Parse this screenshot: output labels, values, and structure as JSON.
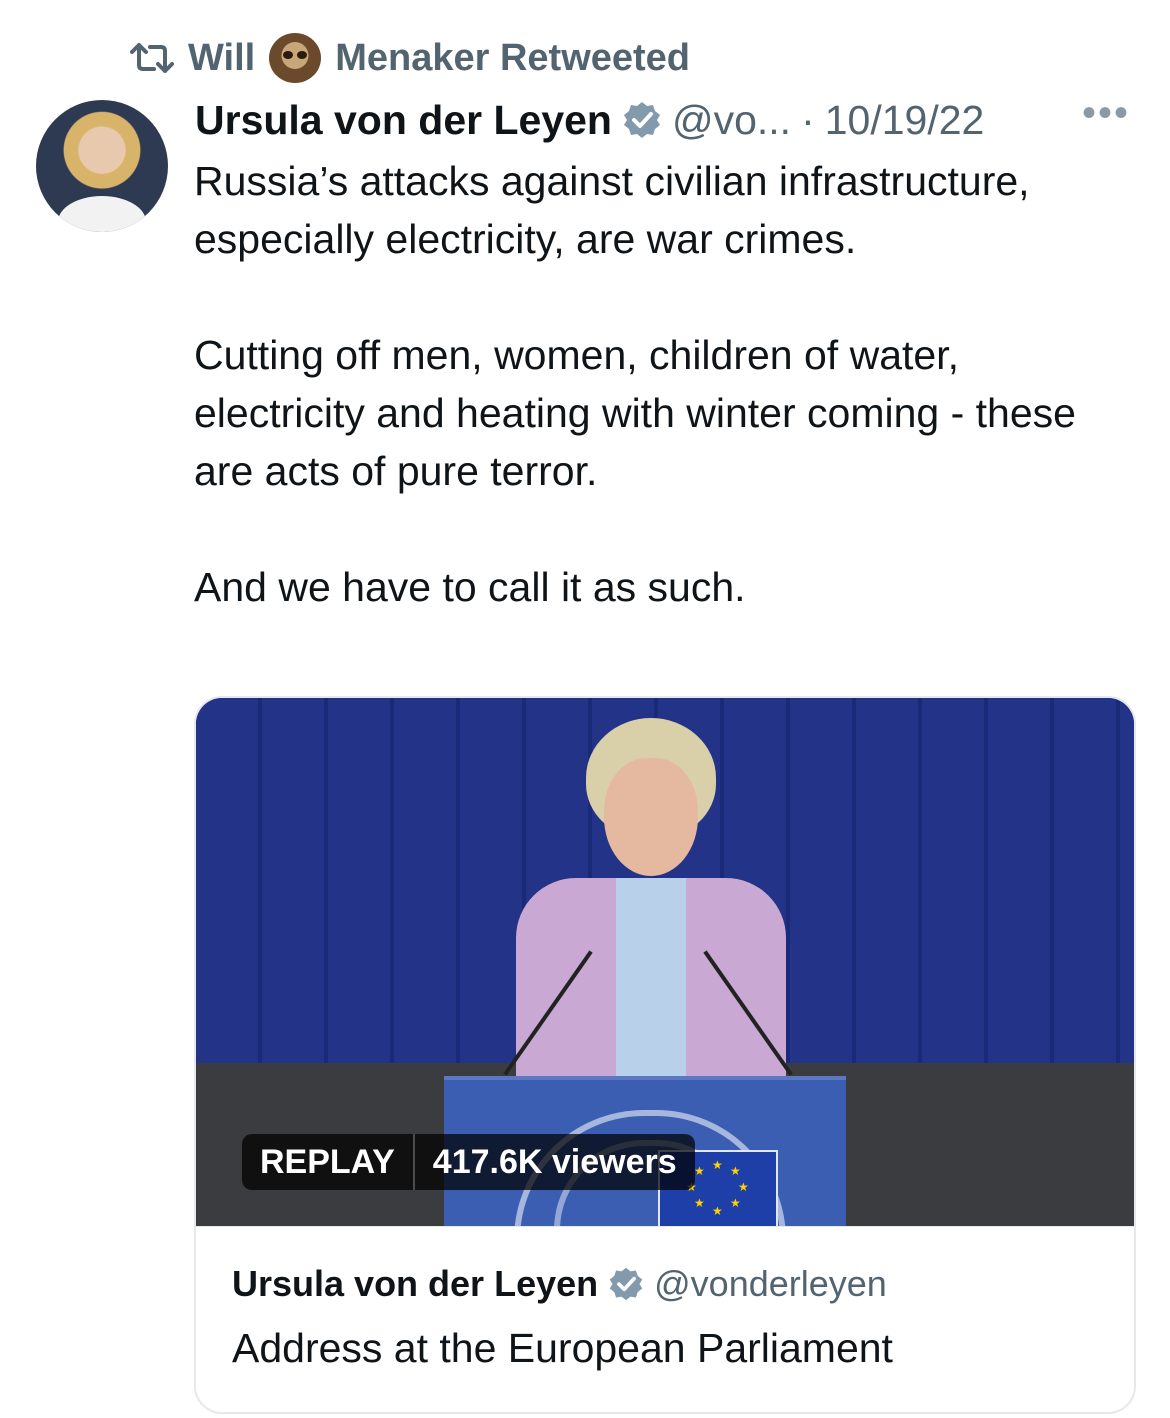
{
  "retweet": {
    "icon": "retweet-icon",
    "first_name": "Will",
    "emoji": "sloth-emoji",
    "rest": "Menaker Retweeted"
  },
  "tweet": {
    "author_name": "Ursula von der Leyen",
    "verified_icon": "verified-badge-icon",
    "handle": "@vo...",
    "separator": "·",
    "date": "10/19/22",
    "more": "•••",
    "paragraphs": [
      "Russia’s attacks against civilian infrastructure, especially electricity, are war crimes.",
      "Cutting off men, women, children of water, electricity and heating with winter coming - these are acts of pure terror.",
      "And we have to call it as such."
    ]
  },
  "media": {
    "replay_label": "REPLAY",
    "viewers_label": "417.6K viewers",
    "card_author_name": "Ursula von der Leyen",
    "card_handle": "@vonderleyen",
    "card_title": "Address at the European Parliament"
  },
  "colors": {
    "text": "#0f1419",
    "muted": "#536471",
    "verified": "#829aab"
  }
}
